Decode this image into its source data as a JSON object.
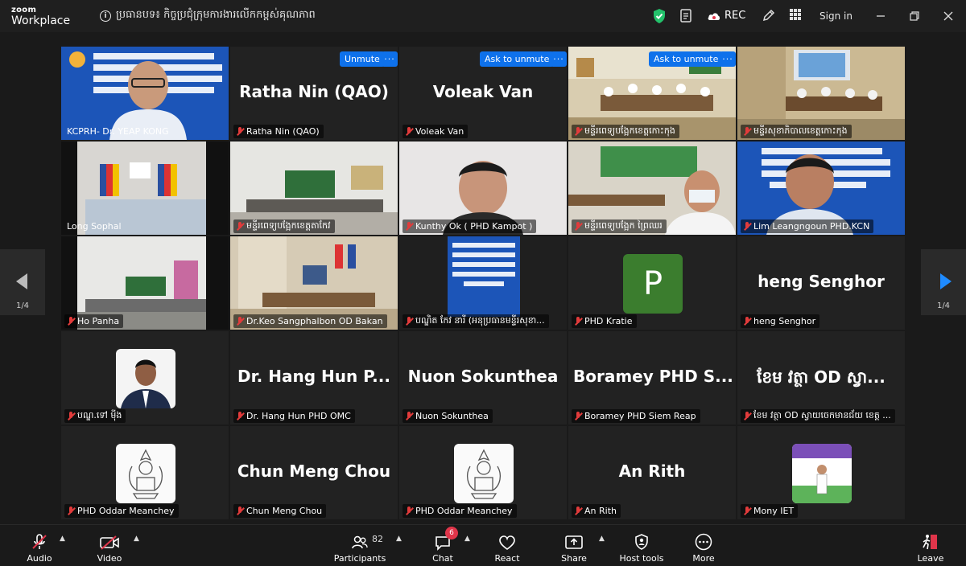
{
  "app": {
    "logo_top": "zoom",
    "logo_bottom": "Workplace"
  },
  "meeting": {
    "topic": "ប្រធានបទ៖ កិច្ចប្រជុំក្រុមការងារលើកកម្ពស់គុណភាព",
    "rec_label": "REC",
    "sign_in": "Sign in"
  },
  "colors": {
    "accent_blue": "#0e71eb",
    "muted_red": "#e23b3b",
    "active_speaker": "#2ed3a0",
    "shield_green": "#23c26b"
  },
  "pager": {
    "left_page": "1/4",
    "right_page": "1/4"
  },
  "tiles": [
    {
      "name": "KCPRH- Dr. YEAP KONG",
      "kind": "video",
      "muted": false,
      "active": true
    },
    {
      "name": "Ratha Nin (QAO)",
      "display": "Ratha Nin (QAO)",
      "kind": "name",
      "button": "Unmute"
    },
    {
      "name": "Voleak Van",
      "display": "Voleak Van",
      "kind": "name",
      "button": "Ask to unmute"
    },
    {
      "name": "មន្ទីរពេទ្យបង្អែកខេត្តកោះកុង",
      "kind": "video",
      "button": "Ask to unmute"
    },
    {
      "name": "មន្ទីរសុខាភិបាលខេត្តកោះកុង",
      "kind": "video"
    },
    {
      "name": "Long Sophal",
      "kind": "video",
      "muted": false
    },
    {
      "name": "មន្ទីរពេទ្យបង្អែកខេត្តតាកែវ",
      "kind": "video"
    },
    {
      "name": "Kunthy Ok ( PHD Kampot )",
      "kind": "video"
    },
    {
      "name": "មន្ទីរពេទ្យបង្អែក ព្រៃឈរ",
      "kind": "video"
    },
    {
      "name": "Lim Leangngoun PHD.KCN",
      "kind": "video"
    },
    {
      "name": "Ho Panha",
      "kind": "video"
    },
    {
      "name": "Dr.Keo Sangphalbon OD Bakan",
      "kind": "video"
    },
    {
      "name": "បណ្ឌិត កែវ នារី (អនុប្រធានមន្ទីរសុខា...",
      "kind": "video"
    },
    {
      "name": "PHD Kratie",
      "kind": "avatar",
      "avatar_letter": "P"
    },
    {
      "name": "heng Senghor",
      "display": "heng Senghor",
      "kind": "name"
    },
    {
      "name": "បណ្ឌ.ទៅ មុីង",
      "kind": "photo"
    },
    {
      "name": "Dr. Hang Hun PHD OMC",
      "display": "Dr. Hang Hun P...",
      "kind": "name"
    },
    {
      "name": "Nuon Sokunthea",
      "display": "Nuon Sokunthea",
      "kind": "name"
    },
    {
      "name": "Boramey PHD Siem Reap",
      "display": "Boramey PHD S...",
      "kind": "name"
    },
    {
      "name": "ខែម វត្ថា  OD ស្វាយចេកមានជ័យ ខេត្ត ...",
      "display": "ខែម វត្ថា  OD ស្វា...",
      "kind": "name"
    },
    {
      "name": "PHD Oddar Meanchey",
      "kind": "emblem"
    },
    {
      "name": "Chun Meng Chou",
      "display": "Chun Meng Chou",
      "kind": "name"
    },
    {
      "name": "PHD Oddar Meanchey",
      "kind": "emblem"
    },
    {
      "name": "An Rith",
      "display": "An Rith",
      "kind": "name"
    },
    {
      "name": "Mony IET",
      "kind": "banner"
    }
  ],
  "toolbar": {
    "audio": "Audio",
    "video": "Video",
    "participants": "Participants",
    "participants_count": "82",
    "chat": "Chat",
    "chat_badge": "6",
    "react": "React",
    "share": "Share",
    "host_tools": "Host tools",
    "more": "More",
    "leave": "Leave"
  }
}
